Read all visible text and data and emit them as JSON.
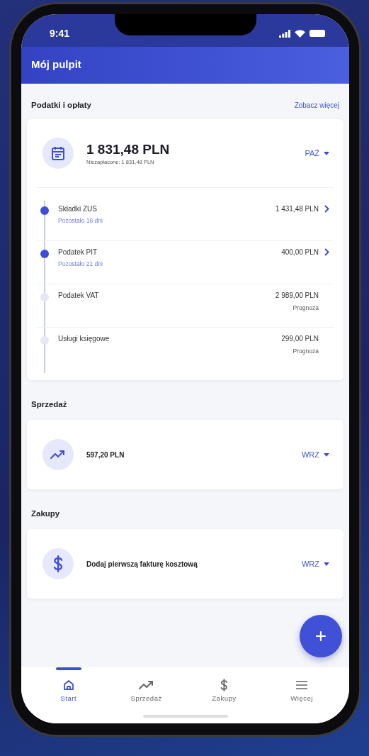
{
  "status_bar": {
    "time": "9:41"
  },
  "header": {
    "title": "Mój pulpit"
  },
  "taxes": {
    "title": "Podatki i opłaty",
    "link": "Zobacz więcej",
    "total": "1 831,48 PLN",
    "unpaid": "Niezapłacone: 1 831,48 PLN",
    "month": "PAŹ",
    "items": [
      {
        "kind": "due",
        "name": "Składki ZUS",
        "note": "Pozostało 16 dni",
        "amount": "1 431,48 PLN"
      },
      {
        "kind": "due",
        "name": "Podatek PIT",
        "note": "Pozostało 21 dni",
        "amount": "400,00 PLN"
      },
      {
        "kind": "forecast",
        "name": "Podatek VAT",
        "note": "Prognoza",
        "amount": "2 989,00 PLN"
      },
      {
        "kind": "forecast",
        "name": "Usługi księgowe",
        "note": "Prognoza",
        "amount": "299,00 PLN"
      }
    ]
  },
  "sales": {
    "title": "Sprzedaż",
    "amount": "597,20 PLN",
    "month": "WRZ"
  },
  "purchases": {
    "title": "Zakupy",
    "text": "Dodaj pierwszą fakturę kosztową",
    "month": "WRZ"
  },
  "fab": {
    "label": "+"
  },
  "nav": [
    {
      "label": "Start",
      "selected": true
    },
    {
      "label": "Sprzedaż",
      "selected": false
    },
    {
      "label": "Zakupy",
      "selected": false
    },
    {
      "label": "Więcej",
      "selected": false
    }
  ]
}
